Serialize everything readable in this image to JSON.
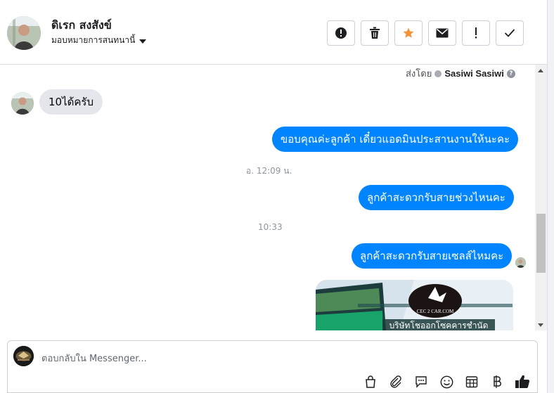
{
  "header": {
    "contact_name": "ดิเรก สงสังข์",
    "assign_label": "มอบหมายการสนทนานี้",
    "actions": [
      {
        "name": "spam-button",
        "icon": "alert-circle-icon"
      },
      {
        "name": "delete-button",
        "icon": "trash-icon"
      },
      {
        "name": "star-button",
        "icon": "star-icon"
      },
      {
        "name": "mark-unread-button",
        "icon": "envelope-icon"
      },
      {
        "name": "follow-up-button",
        "icon": "exclamation-icon"
      },
      {
        "name": "done-button",
        "icon": "check-icon"
      }
    ],
    "star_color": "#f7923b"
  },
  "thread": {
    "sent_by_label": "ส่งโดย",
    "sent_by_name": "Sasiwi Sasiwi",
    "incoming_message": "10ได้ครับ",
    "outgoing_1": "ขอบคุณค่ะลูกค้า เดี๋ยวแอดมินประสานงานให้นะคะ",
    "timestamp_1": "อ. 12:09 น.",
    "outgoing_2": "ลูกค้าสะดวกรับสายช่วงไหนคะ",
    "timestamp_2": "10:33",
    "outgoing_3": "ลูกค้าสะดวกรับสายเซลส์ไหมคะ",
    "image_logo_text": "CEC 2 CAR.COM",
    "image_caption": "บริษัทโชออกโซคคารชำนัด"
  },
  "composer": {
    "placeholder": "ตอบกลับใน Messenger...",
    "tools": [
      "shopping-bag-icon",
      "paperclip-icon",
      "saved-reply-icon",
      "emoji-icon",
      "appointment-icon",
      "baht-payment-icon",
      "thumbs-up-icon"
    ]
  },
  "colors": {
    "outgoing_bubble": "#0084ff",
    "incoming_bubble": "#e4e6eb"
  }
}
